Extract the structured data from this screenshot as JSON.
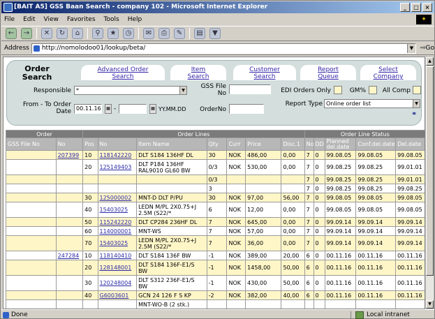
{
  "window": {
    "title": "[BAIT A5] GSS Baan Search - company 102 - Microsoft Internet Explorer",
    "buttons": [
      "_",
      "□",
      "×"
    ]
  },
  "menu": [
    "File",
    "Edit",
    "View",
    "Favorites",
    "Tools",
    "Help"
  ],
  "address": {
    "label": "Address",
    "url": "http://nomolodoo01/lookup/beta/",
    "go": "Go"
  },
  "tabs": {
    "order_search": [
      "Order",
      "Search"
    ],
    "advanced": [
      "Advanced Order",
      "Search"
    ],
    "item": [
      "Item",
      "Search"
    ],
    "customer": [
      "Customer",
      "Search"
    ],
    "report": [
      "Report",
      "Queue"
    ],
    "company": [
      "Select",
      "Company"
    ]
  },
  "form": {
    "responsible_label": "Responsible",
    "responsible_value": "*",
    "gss_file_label": "GSS File No",
    "edi_label": "EDI Orders Only",
    "gm_label": "GM%",
    "allcomp_label": "All Comp",
    "from_to_label": [
      "From - To Order",
      "Date"
    ],
    "from_date": "00.11.16",
    "to_date": "",
    "date_format": "YY.MM.DD",
    "orderno_label": "OrderNo",
    "report_type_label": "Report Type",
    "report_type_value": "Online order list"
  },
  "grid": {
    "groups": [
      "Order",
      "Order Lines",
      "Order Line Status"
    ],
    "columns": [
      "GSS File No",
      "No",
      "Pos",
      "No",
      "Item Name",
      "Qty",
      "Curr",
      "Price",
      "Disc.1",
      "No",
      "DD",
      "Planned del.date",
      "Conf.del.date",
      "Del.date"
    ],
    "rows": [
      {
        "order_no": "207399",
        "pos": "10",
        "line_no": "118142220",
        "item": "DLT S184 136HF DL",
        "qty": "30",
        "curr": "NOK",
        "price": "486,00",
        "disc": "0,00",
        "sno": "7",
        "dd": "0",
        "planned": "99.08.05",
        "conf": "99.08.05",
        "del": "99.08.05"
      },
      {
        "order_no": "",
        "pos": "20",
        "line_no": "125149403",
        "item": "DLT P184 136HF RAL9010 GL60 BW",
        "qty": "0/3",
        "curr": "NOK",
        "price": "530,00",
        "disc": "0,00",
        "sno": "7",
        "dd": "0",
        "planned": "99.08.25",
        "conf": "99.08.25",
        "del": "99.01.01"
      },
      {
        "order_no": "",
        "pos": "",
        "line_no": "",
        "item": "",
        "qty": "0/3",
        "curr": "",
        "price": "",
        "disc": "",
        "sno": "7",
        "dd": "0",
        "planned": "99.08.25",
        "conf": "99.08.25",
        "del": "99.01.01"
      },
      {
        "order_no": "",
        "pos": "",
        "line_no": "",
        "item": "",
        "qty": "3",
        "curr": "",
        "price": "",
        "disc": "",
        "sno": "7",
        "dd": "0",
        "planned": "99.08.25",
        "conf": "99.08.25",
        "del": "99.08.25"
      },
      {
        "order_no": "",
        "pos": "30",
        "line_no": "125000002",
        "item": "MNT-D DLT P/PU",
        "qty": "30",
        "curr": "NOK",
        "price": "97,00",
        "disc": "56,00",
        "sno": "7",
        "dd": "0",
        "planned": "99.08.05",
        "conf": "99.08.05",
        "del": "99.08.05"
      },
      {
        "order_no": "",
        "pos": "40",
        "line_no": "15403025",
        "item": "LEDN M/PL 2X0.75+J 2.5M (S22/*",
        "qty": "6",
        "curr": "NOK",
        "price": "12,00",
        "disc": "0,00",
        "sno": "7",
        "dd": "0",
        "planned": "99.08.05",
        "conf": "99.08.05",
        "del": "99.08.05"
      },
      {
        "order_no": "",
        "pos": "50",
        "line_no": "115242220",
        "item": "DLT CP284 236HF DL",
        "qty": "7",
        "curr": "NOK",
        "price": "645,00",
        "disc": "0,00",
        "sno": "7",
        "dd": "0",
        "planned": "99.09.14",
        "conf": "99.09.14",
        "del": "99.09.14"
      },
      {
        "order_no": "",
        "pos": "60",
        "line_no": "114000001",
        "item": "MNT-WS",
        "qty": "7",
        "curr": "NOK",
        "price": "57,00",
        "disc": "0,00",
        "sno": "7",
        "dd": "0",
        "planned": "99.09.14",
        "conf": "99.09.14",
        "del": "99.09.14"
      },
      {
        "order_no": "",
        "pos": "70",
        "line_no": "15403025",
        "item": "LEDN M/PL 2X0.75+J 2.5M (S22/*",
        "qty": "7",
        "curr": "NOK",
        "price": "36,00",
        "disc": "0,00",
        "sno": "7",
        "dd": "0",
        "planned": "99.09.14",
        "conf": "99.09.14",
        "del": "99.09.14"
      },
      {
        "order_no": "247284",
        "pos": "10",
        "line_no": "118140410",
        "item": "DLT S184 136F BW",
        "qty": "-1",
        "curr": "NOK",
        "price": "389,00",
        "disc": "20,00",
        "sno": "6",
        "dd": "0",
        "planned": "00.11.16",
        "conf": "00.11.16",
        "del": "00.11.16"
      },
      {
        "order_no": "",
        "pos": "20",
        "line_no": "128148001",
        "item": "DLT S184 136F-E1/S BW",
        "qty": "-1",
        "curr": "NOK",
        "price": "1458,00",
        "disc": "50,00",
        "sno": "6",
        "dd": "0",
        "planned": "00.11.16",
        "conf": "00.11.16",
        "del": "00.11.16"
      },
      {
        "order_no": "",
        "pos": "30",
        "line_no": "120248004",
        "item": "DLT S312 236F-E1/S BW",
        "qty": "-1",
        "curr": "NOK",
        "price": "430,00",
        "disc": "50,00",
        "sno": "6",
        "dd": "0",
        "planned": "00.11.16",
        "conf": "00.11.16",
        "del": "00.11.16"
      },
      {
        "order_no": "",
        "pos": "40",
        "line_no": "G6003601",
        "item": "GCN 24 126 F S KP",
        "qty": "-2",
        "curr": "NOK",
        "price": "382,00",
        "disc": "40,00",
        "sno": "6",
        "dd": "0",
        "planned": "00.11.16",
        "conf": "00.11.16",
        "del": "00.11.16"
      },
      {
        "order_no": "",
        "pos": "",
        "line_no": "",
        "item": "MNT-WO-B (2 stk.)",
        "qty": "",
        "curr": "",
        "price": "",
        "disc": "",
        "sno": "",
        "dd": "",
        "planned": "",
        "conf": "",
        "del": ""
      }
    ]
  },
  "status": {
    "left": "Done",
    "zone": "Local intranet"
  }
}
